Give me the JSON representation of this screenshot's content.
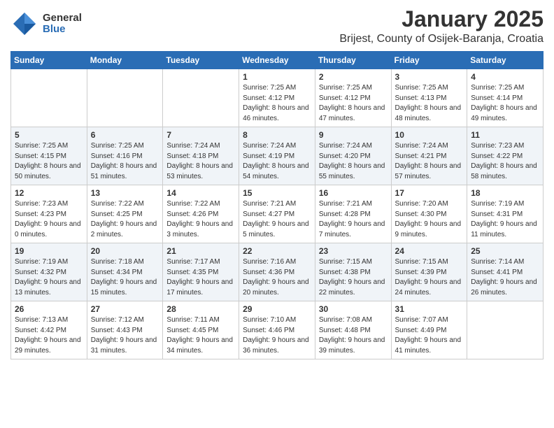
{
  "logo": {
    "general": "General",
    "blue": "Blue"
  },
  "title": "January 2025",
  "subtitle": "Brijest, County of Osijek-Baranja, Croatia",
  "days_header": [
    "Sunday",
    "Monday",
    "Tuesday",
    "Wednesday",
    "Thursday",
    "Friday",
    "Saturday"
  ],
  "weeks": [
    [
      {
        "day": "",
        "info": ""
      },
      {
        "day": "",
        "info": ""
      },
      {
        "day": "",
        "info": ""
      },
      {
        "day": "1",
        "info": "Sunrise: 7:25 AM\nSunset: 4:12 PM\nDaylight: 8 hours and 46 minutes."
      },
      {
        "day": "2",
        "info": "Sunrise: 7:25 AM\nSunset: 4:12 PM\nDaylight: 8 hours and 47 minutes."
      },
      {
        "day": "3",
        "info": "Sunrise: 7:25 AM\nSunset: 4:13 PM\nDaylight: 8 hours and 48 minutes."
      },
      {
        "day": "4",
        "info": "Sunrise: 7:25 AM\nSunset: 4:14 PM\nDaylight: 8 hours and 49 minutes."
      }
    ],
    [
      {
        "day": "5",
        "info": "Sunrise: 7:25 AM\nSunset: 4:15 PM\nDaylight: 8 hours and 50 minutes."
      },
      {
        "day": "6",
        "info": "Sunrise: 7:25 AM\nSunset: 4:16 PM\nDaylight: 8 hours and 51 minutes."
      },
      {
        "day": "7",
        "info": "Sunrise: 7:24 AM\nSunset: 4:18 PM\nDaylight: 8 hours and 53 minutes."
      },
      {
        "day": "8",
        "info": "Sunrise: 7:24 AM\nSunset: 4:19 PM\nDaylight: 8 hours and 54 minutes."
      },
      {
        "day": "9",
        "info": "Sunrise: 7:24 AM\nSunset: 4:20 PM\nDaylight: 8 hours and 55 minutes."
      },
      {
        "day": "10",
        "info": "Sunrise: 7:24 AM\nSunset: 4:21 PM\nDaylight: 8 hours and 57 minutes."
      },
      {
        "day": "11",
        "info": "Sunrise: 7:23 AM\nSunset: 4:22 PM\nDaylight: 8 hours and 58 minutes."
      }
    ],
    [
      {
        "day": "12",
        "info": "Sunrise: 7:23 AM\nSunset: 4:23 PM\nDaylight: 9 hours and 0 minutes."
      },
      {
        "day": "13",
        "info": "Sunrise: 7:22 AM\nSunset: 4:25 PM\nDaylight: 9 hours and 2 minutes."
      },
      {
        "day": "14",
        "info": "Sunrise: 7:22 AM\nSunset: 4:26 PM\nDaylight: 9 hours and 3 minutes."
      },
      {
        "day": "15",
        "info": "Sunrise: 7:21 AM\nSunset: 4:27 PM\nDaylight: 9 hours and 5 minutes."
      },
      {
        "day": "16",
        "info": "Sunrise: 7:21 AM\nSunset: 4:28 PM\nDaylight: 9 hours and 7 minutes."
      },
      {
        "day": "17",
        "info": "Sunrise: 7:20 AM\nSunset: 4:30 PM\nDaylight: 9 hours and 9 minutes."
      },
      {
        "day": "18",
        "info": "Sunrise: 7:19 AM\nSunset: 4:31 PM\nDaylight: 9 hours and 11 minutes."
      }
    ],
    [
      {
        "day": "19",
        "info": "Sunrise: 7:19 AM\nSunset: 4:32 PM\nDaylight: 9 hours and 13 minutes."
      },
      {
        "day": "20",
        "info": "Sunrise: 7:18 AM\nSunset: 4:34 PM\nDaylight: 9 hours and 15 minutes."
      },
      {
        "day": "21",
        "info": "Sunrise: 7:17 AM\nSunset: 4:35 PM\nDaylight: 9 hours and 17 minutes."
      },
      {
        "day": "22",
        "info": "Sunrise: 7:16 AM\nSunset: 4:36 PM\nDaylight: 9 hours and 20 minutes."
      },
      {
        "day": "23",
        "info": "Sunrise: 7:15 AM\nSunset: 4:38 PM\nDaylight: 9 hours and 22 minutes."
      },
      {
        "day": "24",
        "info": "Sunrise: 7:15 AM\nSunset: 4:39 PM\nDaylight: 9 hours and 24 minutes."
      },
      {
        "day": "25",
        "info": "Sunrise: 7:14 AM\nSunset: 4:41 PM\nDaylight: 9 hours and 26 minutes."
      }
    ],
    [
      {
        "day": "26",
        "info": "Sunrise: 7:13 AM\nSunset: 4:42 PM\nDaylight: 9 hours and 29 minutes."
      },
      {
        "day": "27",
        "info": "Sunrise: 7:12 AM\nSunset: 4:43 PM\nDaylight: 9 hours and 31 minutes."
      },
      {
        "day": "28",
        "info": "Sunrise: 7:11 AM\nSunset: 4:45 PM\nDaylight: 9 hours and 34 minutes."
      },
      {
        "day": "29",
        "info": "Sunrise: 7:10 AM\nSunset: 4:46 PM\nDaylight: 9 hours and 36 minutes."
      },
      {
        "day": "30",
        "info": "Sunrise: 7:08 AM\nSunset: 4:48 PM\nDaylight: 9 hours and 39 minutes."
      },
      {
        "day": "31",
        "info": "Sunrise: 7:07 AM\nSunset: 4:49 PM\nDaylight: 9 hours and 41 minutes."
      },
      {
        "day": "",
        "info": ""
      }
    ]
  ]
}
